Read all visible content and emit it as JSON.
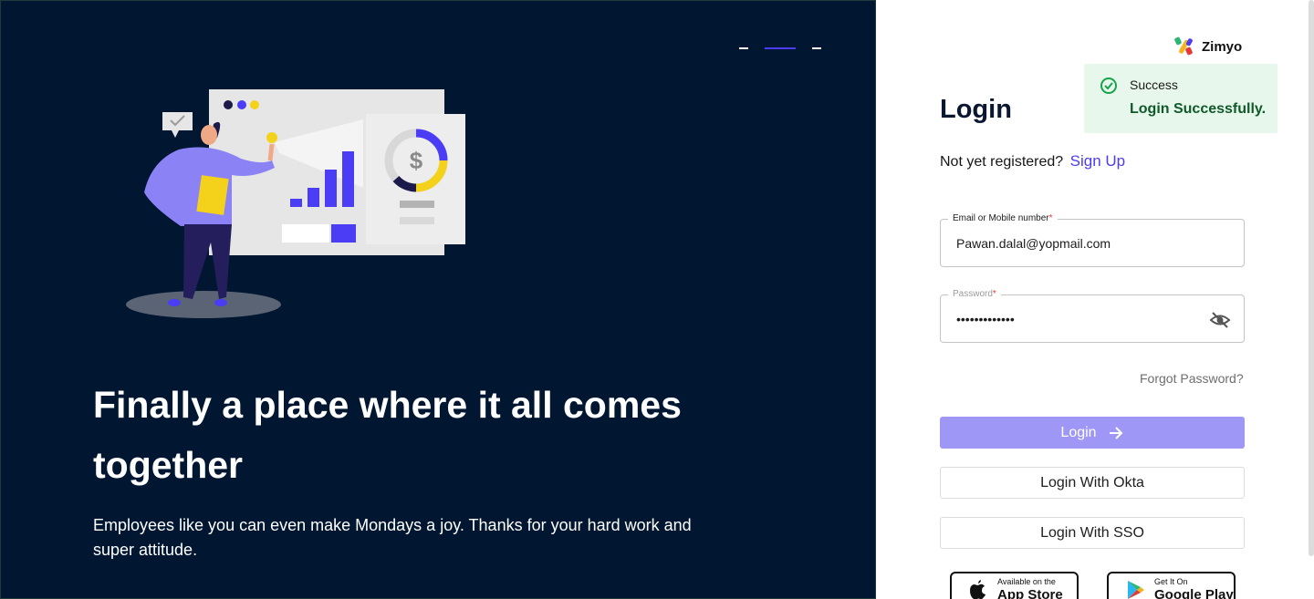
{
  "hero": {
    "title": "Finally a place where it all comes together",
    "subtitle": "Employees like you can even make Mondays a joy. Thanks for your hard work and super attitude.",
    "carousel_active_index": 1,
    "carousel_count": 3
  },
  "brand": {
    "name": "Zimyo"
  },
  "toast": {
    "title": "Success",
    "message": "Login Successfully."
  },
  "login": {
    "title": "Login",
    "register_prompt": "Not yet registered?",
    "signup_link": "Sign Up",
    "email_label": "Email or Mobile number",
    "email_value": "Pawan.dalal@yopmail.com",
    "password_label": "Password",
    "password_value": "•••••••••••••",
    "forgot_password": "Forgot Password?",
    "login_button": "Login",
    "okta_button": "Login With Okta",
    "sso_button": "Login With SSO"
  },
  "stores": {
    "apple_small": "Available on the",
    "apple_big": "App Store",
    "google_small": "Get It On",
    "google_big": "Google Play"
  },
  "colors": {
    "hero_bg": "#011631",
    "accent": "#4b3cf5",
    "login_button": "#9f97f5",
    "toast_bg": "#e8f7ec",
    "toast_text": "#0f5a2a"
  },
  "icons": {
    "toast": "check-circle-icon",
    "password_toggle": "eye-off-icon",
    "login_arrow": "arrow-right-icon",
    "apple": "apple-icon",
    "google": "google-play-icon"
  }
}
